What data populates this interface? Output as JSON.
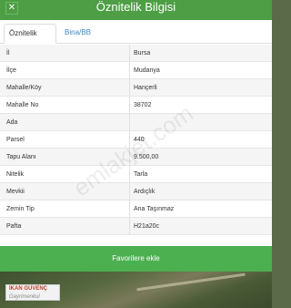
{
  "window": {
    "title": "Öznitelik Bilgisi"
  },
  "tabs": [
    {
      "label": "Öznitelik Bilgisi"
    },
    {
      "label": "Bina/BB Listesi"
    }
  ],
  "attributes": [
    {
      "key": "İl",
      "value": "Bursa"
    },
    {
      "key": "İlçe",
      "value": "Mudanya"
    },
    {
      "key": "Mahalle/Köy",
      "value": "Hançerli"
    },
    {
      "key": "Mahalle No",
      "value": "38702"
    },
    {
      "key": "Ada",
      "value": ""
    },
    {
      "key": "Parsel",
      "value": "440"
    },
    {
      "key": "Tapu Alanı",
      "value": "9.500,00"
    },
    {
      "key": "Nitelik",
      "value": "Tarla"
    },
    {
      "key": "Mevkii",
      "value": "Ardıçlık"
    },
    {
      "key": "Zemin Tip",
      "value": "Ana Taşınmaz"
    },
    {
      "key": "Pafta",
      "value": "H21a20c"
    }
  ],
  "actions": {
    "favorite_label": "Favorilere ekle"
  },
  "watermark": "emlakjet.com",
  "map_logo": {
    "line1": "İKAN GÜVENÇ",
    "line2": "Gayrimenkul"
  },
  "colors": {
    "header": "#4d9e45",
    "button": "#4caf50",
    "tab_link": "#3a87c8"
  }
}
